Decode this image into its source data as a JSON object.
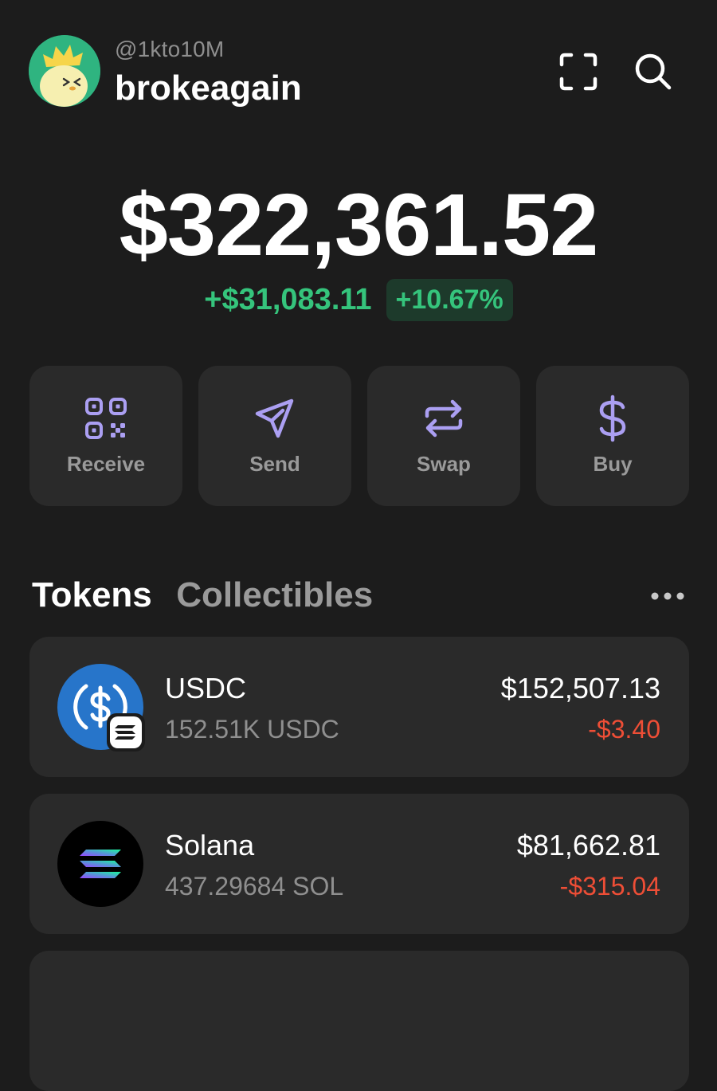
{
  "profile": {
    "handle": "@1kto10M",
    "username": "brokeagain",
    "avatar_icon": "cartoon-chick-avatar-icon"
  },
  "header_actions": {
    "scan_icon": "scan-icon",
    "search_icon": "search-icon"
  },
  "portfolio": {
    "balance": "$322,361.52",
    "change_amount": "+$31,083.11",
    "change_percent": "+10.67%"
  },
  "actions": [
    {
      "label": "Receive",
      "icon": "qr-code-icon"
    },
    {
      "label": "Send",
      "icon": "send-arrow-icon"
    },
    {
      "label": "Swap",
      "icon": "swap-arrows-icon"
    },
    {
      "label": "Buy",
      "icon": "dollar-icon"
    }
  ],
  "tabs": [
    {
      "label": "Tokens",
      "active": true
    },
    {
      "label": "Collectibles",
      "active": false
    }
  ],
  "more_icon": "more-dots-icon",
  "tokens": [
    {
      "name": "USDC",
      "amount": "152.51K USDC",
      "value": "$152,507.13",
      "change": "-$3.40",
      "icon": "usdc-logo-icon",
      "chain_badge": "solana-badge-icon"
    },
    {
      "name": "Solana",
      "amount": "437.29684 SOL",
      "value": "$81,662.81",
      "change": "-$315.04",
      "icon": "solana-logo-icon"
    }
  ],
  "colors": {
    "background": "#1c1c1c",
    "card": "#2a2a2a",
    "accent_purple": "#ab9ff2",
    "positive": "#35c47c",
    "negative": "#ee4e36",
    "usdc_blue": "#2775ca"
  }
}
